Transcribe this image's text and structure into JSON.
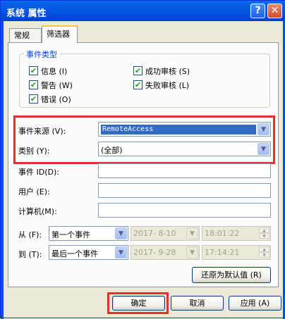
{
  "window": {
    "title": "系统 属性",
    "help_glyph": "?",
    "close_glyph": "✕"
  },
  "tabs": [
    {
      "label": "常规"
    },
    {
      "label": "筛选器"
    }
  ],
  "event_types": {
    "group_label": "事件类型",
    "items": [
      {
        "label": "信息 (I)",
        "checked": true
      },
      {
        "label": "警告 (W)",
        "checked": true
      },
      {
        "label": "错误 (O)",
        "checked": true
      },
      {
        "label": "成功审核 (S)",
        "checked": true
      },
      {
        "label": "失败审核 (L)",
        "checked": true
      }
    ]
  },
  "fields": {
    "event_source": {
      "label": "事件来源 (V):",
      "value": "RemoteAccess"
    },
    "category": {
      "label": "类别 (Y):",
      "value": "(全部)"
    },
    "event_id": {
      "label": "事件 ID(D):",
      "value": ""
    },
    "user": {
      "label": "用户 (E):",
      "value": ""
    },
    "computer": {
      "label": "计算机(M):",
      "value": ""
    },
    "from": {
      "label": "从 (F):",
      "mode": "第一个事件",
      "date": "2017- 8-10",
      "time": "18:01:22"
    },
    "to": {
      "label": "到 (T):",
      "mode": "最后一个事件",
      "date": "2017- 9-28",
      "time": "17:14:21"
    }
  },
  "buttons": {
    "restore_defaults": "还原为默认值 (R)",
    "ok": "确定",
    "cancel": "取消",
    "apply": "应用 (A)"
  },
  "icons": {
    "check": "✔",
    "dropdown": "▼",
    "spin_up": "▲",
    "spin_down": "▼"
  },
  "colors": {
    "highlight_red": "#e0322c",
    "title_blue": "#0456e3",
    "selection_blue": "#316ac5"
  }
}
